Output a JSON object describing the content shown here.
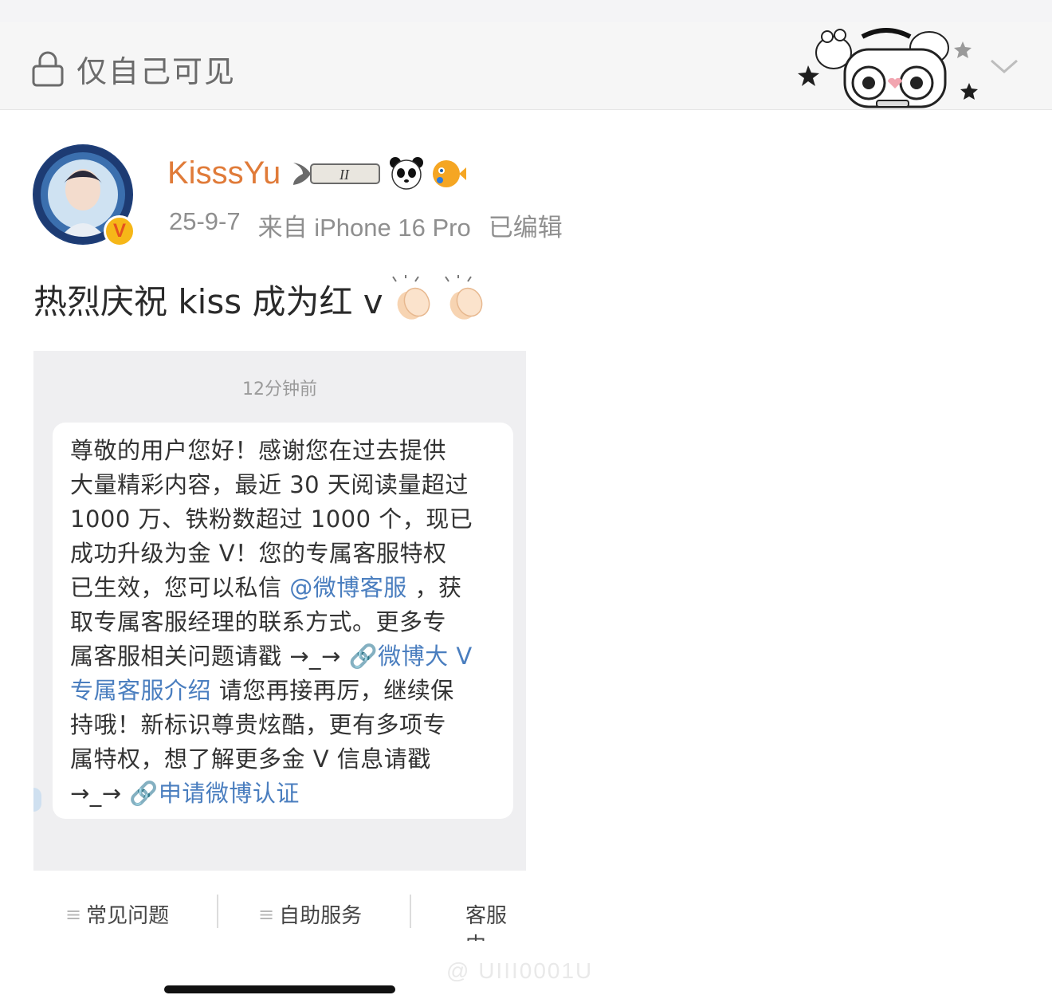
{
  "header": {
    "visibility_label": "仅自己可见"
  },
  "post": {
    "author": "KisssYu",
    "date": "25-9-7",
    "source": "来自 iPhone 16 Pro",
    "edited": "已编辑",
    "text": "热烈庆祝 kiss 成为红 v",
    "emoji": "clapping-hands"
  },
  "image": {
    "timestamp": "12分钟前",
    "message": {
      "l1": "尊敬的用户您好！感谢您在过去提供",
      "l2": "大量精彩内容，最近 30 天阅读量超过",
      "l3": "1000 万、铁粉数超过 1000 个，现已",
      "l4": "成功升级为金 V！您的专属客服特权",
      "l5a": "已生效，您可以私信 ",
      "l5_link": "@微博客服",
      "l5b": " ，获",
      "l6": "取专属客服经理的联系方式。更多专",
      "l7a": "属客服相关问题请戳 →_→ ",
      "l7_link": "🔗微博大 V",
      "l8_link": "专属客服介绍",
      "l8b": " 请您再接再厉，继续保",
      "l9": "持哦！新标识尊贵炫酷，更有多项专",
      "l10": "属特权，想了解更多金 V 信息请戳",
      "l11a": "→_→ ",
      "l11_link": "🔗申请微博认证"
    },
    "bottom_tabs": [
      "常见问题",
      "自助服务",
      "客服中"
    ],
    "menu_glyph": "≡"
  },
  "watermark": "@ UIII0001U",
  "colors": {
    "username": "#e07b39",
    "link": "#4a7ebf",
    "badge": "#f6b718"
  }
}
